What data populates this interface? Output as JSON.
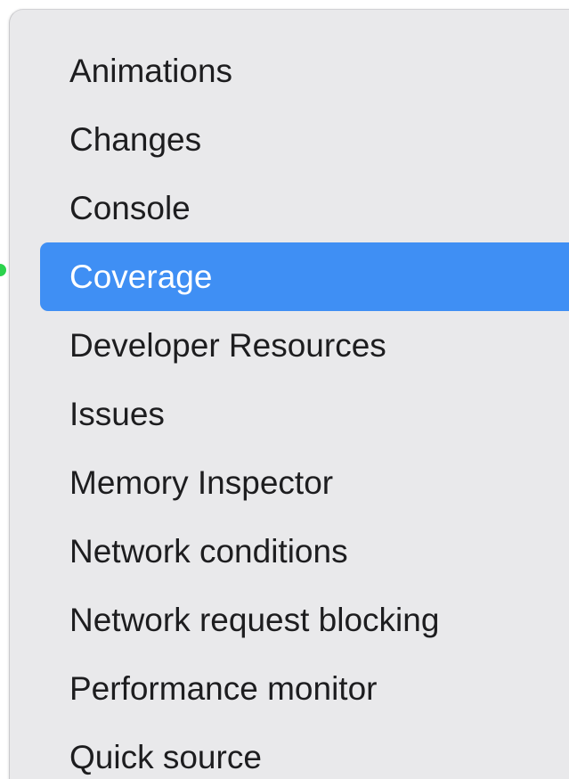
{
  "menu": {
    "items": [
      {
        "label": "Animations",
        "selected": false
      },
      {
        "label": "Changes",
        "selected": false
      },
      {
        "label": "Console",
        "selected": false
      },
      {
        "label": "Coverage",
        "selected": true
      },
      {
        "label": "Developer Resources",
        "selected": false
      },
      {
        "label": "Issues",
        "selected": false
      },
      {
        "label": "Memory Inspector",
        "selected": false
      },
      {
        "label": "Network conditions",
        "selected": false
      },
      {
        "label": "Network request blocking",
        "selected": false
      },
      {
        "label": "Performance monitor",
        "selected": false
      },
      {
        "label": "Quick source",
        "selected": false
      }
    ]
  },
  "colors": {
    "menu_background": "#e9e9eb",
    "selection_accent": "#3f8ff4",
    "indicator": "#2bd24c"
  }
}
